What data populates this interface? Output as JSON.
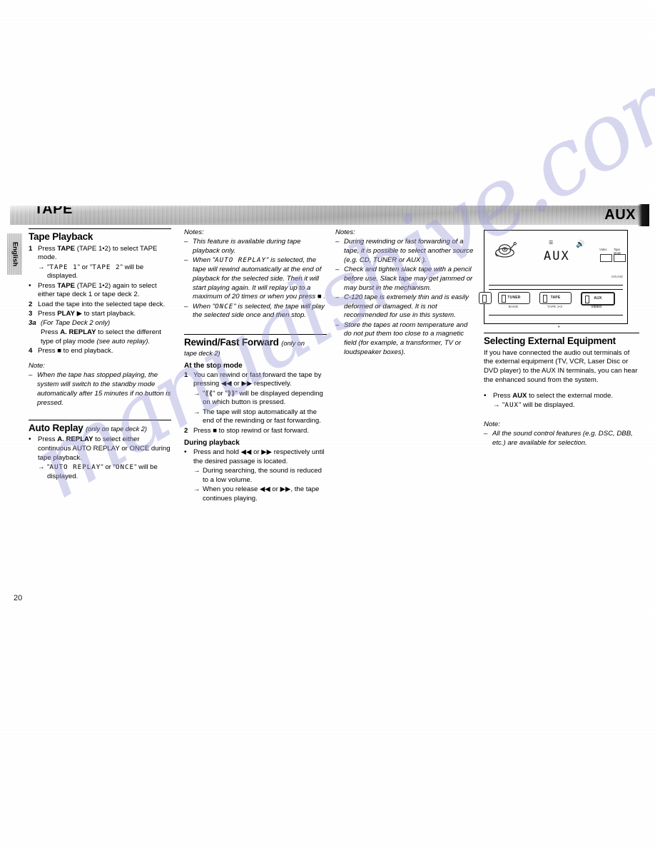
{
  "page": {
    "number": "20",
    "side_tab": "English",
    "header_left": "TAPE",
    "header_right": "AUX",
    "watermark": "manualshive.com"
  },
  "col1": {
    "heading": "Tape Playback",
    "steps": [
      {
        "marker": "1",
        "text": "Press TAPE (TAPE 1•2) to select TAPE mode."
      },
      {
        "marker": "→",
        "text": "\"TAPE 1\" or \"TAPE 2\" will be displayed."
      },
      {
        "marker": "•",
        "text": "Press TAPE (TAPE 1•2) again to select either tape deck 1 or tape deck 2."
      },
      {
        "marker": "2",
        "text": "Load the tape into the selected tape deck."
      },
      {
        "marker": "3",
        "text": "Press PLAY ▶ to start playback."
      },
      {
        "marker": "3a",
        "text": "(For Tape Deck 2 only)"
      },
      {
        "marker": "",
        "text": "Press A. REPLAY to select the different type of play mode (see auto replay)."
      },
      {
        "marker": "4",
        "text": "Press ■ to end playback."
      }
    ],
    "step1_a": "Press ",
    "step1_tape": "TAPE",
    "step1_b": " (TAPE 1•2) to select TAPE mode.",
    "step1_arrow_pre": "\"",
    "step1_arrow_lcd1": "TAPE  1",
    "step1_arrow_mid": "\" or \"",
    "step1_arrow_lcd2": "TAPE  2",
    "step1_arrow_post": "\" will be displayed.",
    "bullet1_a": "Press ",
    "bullet1_tape": "TAPE",
    "bullet1_b": " (TAPE 1•2) again to select either tape deck 1 or tape deck 2.",
    "step2": "Load the tape into the selected tape deck.",
    "step3_a": "Press ",
    "step3_play": "PLAY",
    "step3_b": " ▶ to start playback.",
    "step3a_marker": "3a",
    "step3a_text": "(For Tape Deck 2 only)",
    "step3a_body_a": "Press ",
    "step3a_cmd": "A. REPLAY",
    "step3a_body_b": " to select the different type of play mode ",
    "step3a_body_i": "(see auto replay).",
    "step4_a": "Press ■ to end playback.",
    "note_label": "Note:",
    "note_text": "When the tape has stopped playing, the system will switch to the standby mode automatically after 15 minutes if no button is pressed.",
    "auto_heading": "Auto Replay",
    "auto_heading_sub": "(only on tape deck 2)",
    "auto_bullet_a": "Press ",
    "auto_bullet_cmd": "A. REPLAY",
    "auto_bullet_b": " to select either continuous AUTO REPLAY or ONCE during tape playback.",
    "auto_arrow_pre": "\"",
    "auto_arrow_lcd1": "AUTO REPLAY",
    "auto_arrow_mid": "\" or \"",
    "auto_arrow_lcd2": "ONCE",
    "auto_arrow_post": "\" will be displayed."
  },
  "col2": {
    "notes_label": "Notes:",
    "note1": "This feature is available during tape playback only.",
    "note2_pre": "When \"",
    "note2_lcd": "AUTO REPLAY",
    "note2_post": "\" is selected, the tape will rewind automatically at the end of playback for the selected side. Then it will start playing again. It will replay up to a maximum of 20 times or when you press  ■ .",
    "note3_pre": "When \"",
    "note3_lcd": "ONCE",
    "note3_post": "\" is selected, the tape will play the selected side once and then stop.",
    "rff_heading": "Rewind/Fast Forward",
    "rff_heading_sub": "(only on",
    "rff_heading_sub2": "tape deck 2)",
    "stop_subhead": "At the stop mode",
    "stop_step1": "You can rewind or fast forward the tape by pressing ◀◀ or ▶▶ respectively.",
    "stop_arrow1": "\"⟪⟪\" or \"⟫⟫\" will be displayed depending on which button is pressed.",
    "stop_arrow2": "The tape will stop automatically at the end of the rewinding or fast forwarding.",
    "stop_step2": "Press ■ to stop rewind or fast forward.",
    "play_subhead": "During playback",
    "play_bullet": "Press and hold ◀◀ or ▶▶ respectively until the desired passage is located.",
    "play_arrow1": "During searching, the sound is reduced to a low volume.",
    "play_arrow2": "When you release ◀◀ or ▶▶, the tape continues playing."
  },
  "col3": {
    "notes_label": "Notes:",
    "note1": "During rewinding or fast forwarding of a tape, it is possible to select another source (e.g. CD, TUNER or AUX ).",
    "note2": "Check and tighten slack tape with a pencil before use.  Slack tape may get jammed or may burst in the mechanism.",
    "note3": "C-120 tape is extremely thin and is easily deformed or damaged.  It is not recommended for use in this system.",
    "note4": "Store the tapes at room temperature and do not put them too close to a magnetic field (for example, a transformer, TV or loudspeaker boxes)."
  },
  "col4": {
    "figure": {
      "display_text": "AUX",
      "corner_label": "SOUND",
      "mode_label_1": "Video",
      "mode_label_2": "Tape Mode",
      "buttons": [
        {
          "name": "TUNER",
          "sub": "BAND"
        },
        {
          "name": "TAPE",
          "sub": "TAPE 1•2"
        },
        {
          "name": "AUX",
          "sub": "VIDEO"
        }
      ]
    },
    "heading": "Selecting External Equipment",
    "paragraph": "If you have connected the audio out terminals of the external equipment (TV, VCR, Laser Disc or DVD player) to the AUX IN terminals, you can hear the enhanced sound from the system.",
    "bullet_a": "Press ",
    "bullet_cmd": "AUX",
    "bullet_b": " to select the external mode.",
    "arrow_pre": "\"",
    "arrow_lcd": "AUX",
    "arrow_post": "\" will be displayed.",
    "note_label": "Note:",
    "note_text": "All the sound control features (e.g. DSC, DBB, etc.) are available for selection."
  }
}
